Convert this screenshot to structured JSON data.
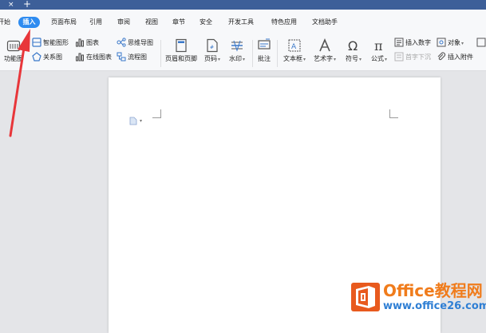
{
  "window": {
    "close_glyph": "×",
    "add_glyph": "+"
  },
  "menu": {
    "items": [
      "开始",
      "插入",
      "页面布局",
      "引用",
      "审阅",
      "视图",
      "章节",
      "安全",
      "开发工具",
      "特色应用",
      "文档助手"
    ],
    "active": "插入"
  },
  "ribbon": {
    "function_chart": "功能图",
    "smart_shape": "智能图形",
    "chart": "图表",
    "mind_map": "思维导图",
    "relation_chart": "关系图",
    "online_chart": "在线图表",
    "flowchart": "流程图",
    "header_footer": "页眉和页脚",
    "page_number": "页码",
    "watermark": "水印",
    "comment": "批注",
    "textbox": "文本框",
    "art_text": "艺术字",
    "symbol": "符号",
    "formula": "公式",
    "insert_number": "插入数字",
    "object": "对象",
    "drop_cap": "首字下沉",
    "insert_attachment": "插入附件"
  },
  "watermark_brand": {
    "title": "Office教程网",
    "url": "www.office26.com"
  },
  "colors": {
    "accent": "#2e8bf0",
    "title_bar": "#3d5f99",
    "arrow": "#e8363a",
    "brand_orange": "#f07c1c",
    "brand_blue": "#2f7fd4"
  }
}
